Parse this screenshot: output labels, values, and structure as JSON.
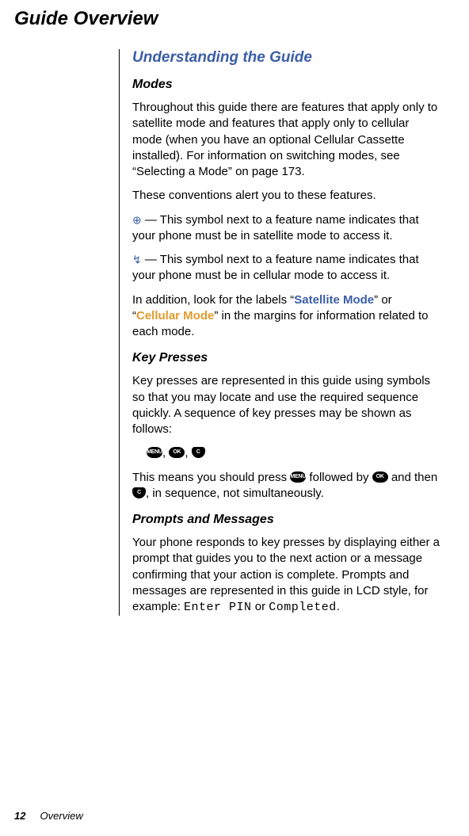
{
  "title": "Guide Overview",
  "section": {
    "heading": "Understanding the Guide",
    "modes": {
      "heading": "Modes",
      "p1": "Throughout this guide there are features that apply only to satellite mode and features that apply only to cellular mode (when you have an optional Cellular Cassette installed). For information on switching modes, see “Selecting a Mode” on page 173.",
      "p2": "These conventions alert you to these features.",
      "sat_text": " — This symbol next to a feature name indicates that your phone must be in satellite mode to access it.",
      "cell_text": " — This symbol next to a feature name indicates that your phone must be in cellular mode to access it.",
      "p5a": "In addition, look for the labels “",
      "sat_label": "Satellite Mode",
      "p5b": "” or “",
      "cell_label": "Cellular Mode",
      "p5c": "” in the margins for information related to each mode."
    },
    "keypresses": {
      "heading": "Key Presses",
      "p1": "Key presses are represented in this guide using symbols so that you may locate and use the required sequence quickly. A sequence of key presses may be shown as follows:",
      "menu": "MENU",
      "ok": "OK",
      "c": "C",
      "sep": ", ",
      "p2a": "This means you should press ",
      "p2b": " followed by ",
      "p2c": " and then ",
      "p2d": ", in sequence, not simultaneously."
    },
    "prompts": {
      "heading": "Prompts and Messages",
      "p1a": "Your phone responds to key presses by displaying either a prompt that guides you to the next action or a message confirming that your action is complete. Prompts and messages are represented in this guide in LCD style, for example: ",
      "lcd1": "Enter PIN",
      "p1b": " or ",
      "lcd2": "Completed",
      "p1c": "."
    }
  },
  "footer": {
    "page_number": "12",
    "section_name": "Overview"
  },
  "icons": {
    "satellite": "⊕",
    "cellular": "↯"
  }
}
